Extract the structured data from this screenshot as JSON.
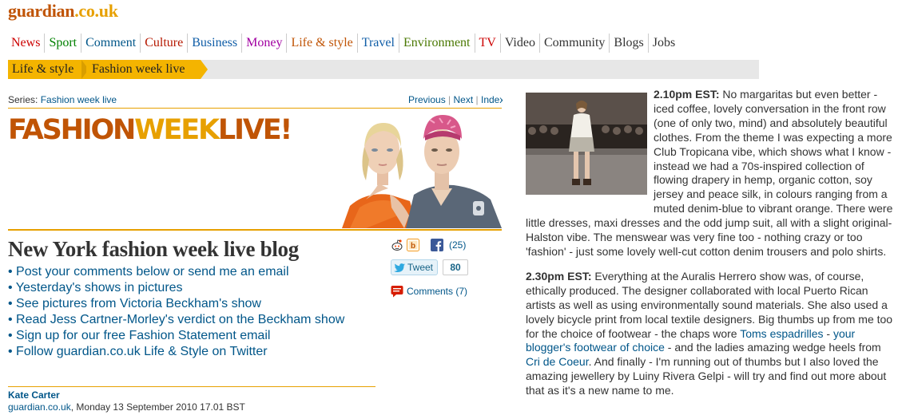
{
  "masthead": {
    "logo_a": "guardian",
    "logo_b": ".co.uk"
  },
  "nav": [
    {
      "label": "News",
      "color": "#cc0000"
    },
    {
      "label": "Sport",
      "color": "#008000"
    },
    {
      "label": "Comment",
      "color": "#005689"
    },
    {
      "label": "Culture",
      "color": "#b51800"
    },
    {
      "label": "Business",
      "color": "#0f5da7"
    },
    {
      "label": "Money",
      "color": "#a100a1"
    },
    {
      "label": "Life & style",
      "color": "#c05405"
    },
    {
      "label": "Travel",
      "color": "#0f5da7"
    },
    {
      "label": "Environment",
      "color": "#4a7801"
    },
    {
      "label": "TV",
      "color": "#cc0000"
    },
    {
      "label": "Video",
      "color": "#333333"
    },
    {
      "label": "Community",
      "color": "#333333"
    },
    {
      "label": "Blogs",
      "color": "#333333"
    },
    {
      "label": "Jobs",
      "color": "#333333"
    }
  ],
  "breadcrumbs": [
    "Life & style",
    "Fashion week live"
  ],
  "series": {
    "prefix": "Series:",
    "name": "Fashion week live"
  },
  "pager": {
    "previous": "Previous",
    "sep1": "|",
    "next": "Next",
    "sep2": "|",
    "index": "Index"
  },
  "banner": {
    "part1": "FASHION",
    "part2": "WEEK",
    "part3": "LIVE!"
  },
  "headline": "New York fashion week live blog",
  "links": [
    "Post your comments below or send me an email",
    "Yesterday's shows in pictures",
    "See pictures from Victoria Beckham's show",
    "Read Jess Cartner-Morley's verdict on the Beckham show",
    "Sign up for our free Fashion Statement email",
    "Follow guardian.co.uk Life & Style on Twitter"
  ],
  "share": {
    "fb_count": "(25)",
    "tweet_label": "Tweet",
    "tweet_count": "80",
    "comments_label": "Comments (7)"
  },
  "author": {
    "name": "Kate Carter",
    "site": "guardian.co.uk",
    "date": ", Monday 13 September 2010 17.01 BST"
  },
  "article": {
    "p1_time": "2.10pm EST:",
    "p1_text": " No margaritas but even better - iced coffee, lovely conversation in the front row (one of only two, mind) and absolutely beautiful clothes. From the theme I was expecting a more Club Tropicana vibe, which shows what I know - instead we had a 70s-inspired collection of flowing drapery in hemp, organic cotton, soy jersey and peace silk, in colours ranging from a muted denim-blue to vibrant orange. There were little dresses, maxi dresses and the odd jump suit, all with a slight original-Halston vibe. The menswear was very fine too - nothing crazy or too 'fashion' - just some lovely well-cut cotton denim trousers and polo shirts.",
    "p2_time": "2.30pm EST:",
    "p2_a": " Everything at the Auralis Herrero show was, of course, ethically produced. The designer collaborated with local Puerto Rican artists as well as using environmentally sound materials. She also used a lovely bicycle print from local textile designers. Big thumbs up from me too for the choice of footwear - the chaps wore ",
    "p2_link1": "Toms espadrilles",
    "p2_b": " - ",
    "p2_link2": "your blogger's footwear of choice",
    "p2_c": " - and the ladies amazing wedge heels from ",
    "p2_link3": "Cri de Coeur",
    "p2_d": ". And finally - I'm running out of thumbs but I also loved the amazing jewellery by Luiny Rivera Gelpi - will try and find out more about that as it's a new name to me."
  }
}
